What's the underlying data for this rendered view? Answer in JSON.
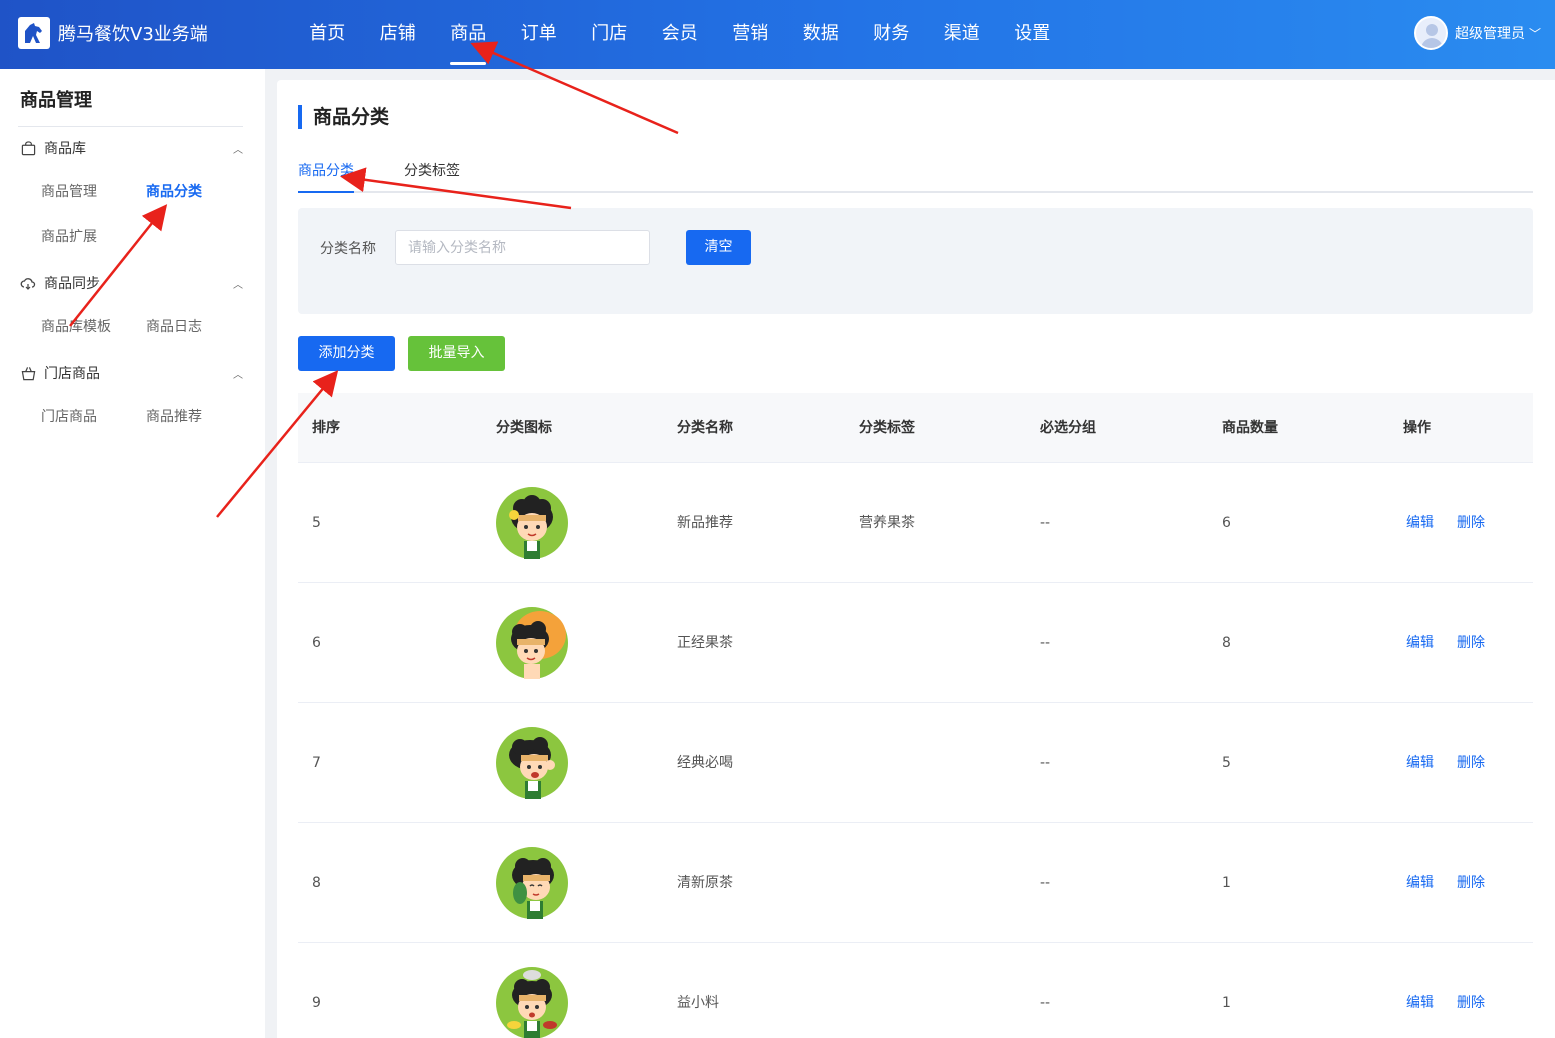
{
  "header": {
    "app_title": "腾马餐饮V3业务端",
    "nav": [
      "首页",
      "店铺",
      "商品",
      "订单",
      "门店",
      "会员",
      "营销",
      "数据",
      "财务",
      "渠道",
      "设置"
    ],
    "active_nav": "商品",
    "user_name": "超级管理员",
    "user_caret": "﹀"
  },
  "sidebar": {
    "title": "商品管理",
    "groups": [
      {
        "label": "商品库",
        "icon": "bag-icon",
        "items": [
          "商品管理",
          "商品分类",
          "商品扩展"
        ]
      },
      {
        "label": "商品同步",
        "icon": "cloud-sync-icon",
        "items": [
          "商品库模板",
          "商品日志"
        ]
      },
      {
        "label": "门店商品",
        "icon": "basket-icon",
        "items": [
          "门店商品",
          "商品推荐"
        ]
      }
    ],
    "active_item": "商品分类"
  },
  "main": {
    "page_title": "商品分类",
    "tabs": [
      "商品分类",
      "分类标签"
    ],
    "active_tab": "商品分类",
    "filter": {
      "label": "分类名称",
      "placeholder": "请输入分类名称",
      "value": "",
      "clear_label": "清空"
    },
    "actions": {
      "add_label": "添加分类",
      "import_label": "批量导入"
    },
    "table": {
      "columns": [
        "排序",
        "分类图标",
        "分类名称",
        "分类标签",
        "必选分组",
        "商品数量",
        "操作"
      ],
      "rows": [
        {
          "sort": "5",
          "icon": "mascot-green-icon",
          "name": "新品推荐",
          "tag": "营养果茶",
          "required_group": "--",
          "count": "6",
          "edit": "编辑",
          "delete": "删除"
        },
        {
          "sort": "6",
          "icon": "mascot-orange-icon",
          "name": "正经果茶",
          "tag": "",
          "required_group": "--",
          "count": "8",
          "edit": "编辑",
          "delete": "删除"
        },
        {
          "sort": "7",
          "icon": "mascot-green-icon",
          "name": "经典必喝",
          "tag": "",
          "required_group": "--",
          "count": "5",
          "edit": "编辑",
          "delete": "删除"
        },
        {
          "sort": "8",
          "icon": "mascot-green-icon",
          "name": "清新原茶",
          "tag": "",
          "required_group": "--",
          "count": "1",
          "edit": "编辑",
          "delete": "删除"
        },
        {
          "sort": "9",
          "icon": "mascot-green-icon",
          "name": "益小料",
          "tag": "",
          "required_group": "--",
          "count": "1",
          "edit": "编辑",
          "delete": "删除"
        }
      ]
    }
  },
  "colors": {
    "primary": "#1769f1",
    "success": "#66c23a",
    "header_start": "#1f53c7",
    "header_end": "#2a8cf0",
    "annotation_arrow": "#e8221b",
    "mascot_green": "#8cc63f",
    "mascot_orange": "#f4a23a"
  }
}
